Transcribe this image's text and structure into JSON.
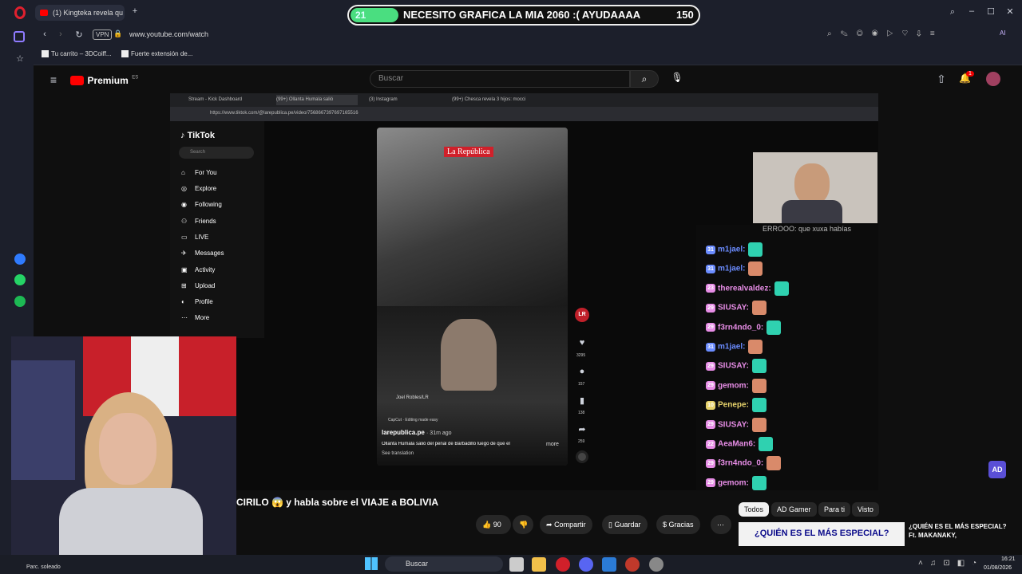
{
  "browser": {
    "tab_title": "(1) Kingteka revela qu",
    "url": "www.youtube.com/watch",
    "bookmarks": [
      "Tu carrito – 3DCoiff...",
      "Fuerte extensión de..."
    ],
    "vpn_label": "VPN",
    "ai_label": "AI"
  },
  "goal_banner": {
    "current": "21",
    "text": "NECESITO GRAFICA LA MIA 2060 :( AYUDAAAA",
    "target": "150"
  },
  "youtube": {
    "logo": "Premium",
    "logo_sup": "ES",
    "search_placeholder": "Buscar",
    "notif_count": "1",
    "video_title_suffix": "CIRILO 😱 y habla sobre el VIAJE a BOLIVIA",
    "likes": "90",
    "share": "Compartir",
    "save": "Guardar",
    "thanks": "Gracias",
    "chips": [
      "Todos",
      "AD Gamer",
      "Para ti",
      "Visto"
    ],
    "rec_title": "¿QUIÉN ES EL MÁS ESPECIAL? Ft. MAKANAKY,",
    "rec_thumb_text": "¿QUIÉN ES EL MÁS ESPECIAL?"
  },
  "inner_browser": {
    "tabs": [
      "Stream - Kick Dashboard",
      "(99+) Ollanta Humala salió",
      "(3) Instagram",
      "(99+) Chesca revela 3 hijos: mocci"
    ],
    "url": "https://www.tiktok.com/@larepublica.pe/video/7568667397697165516"
  },
  "tiktok": {
    "logo": "TikTok",
    "search": "Search",
    "menu": [
      "For You",
      "Explore",
      "Following",
      "Friends",
      "LIVE",
      "Messages",
      "Activity",
      "Upload",
      "Profile",
      "More"
    ],
    "overlay_brand": "La República",
    "author": "larepublica.pe",
    "time": "· 31m ago",
    "caption": "Ollanta Humala salió del penal de Barbadillo luego de que el",
    "more": "more",
    "see_translation": "See translation",
    "capcut": "CapCut · Editing made easy",
    "credit": "Joel Robles/LR",
    "lr_badge": "LR",
    "counts": [
      "3295",
      "157",
      "138",
      "259"
    ]
  },
  "chat": {
    "header": "ERROOO: que xuxa habías",
    "messages": [
      {
        "user": "m1jael:",
        "badge": "31",
        "color": "#6b8cff"
      },
      {
        "user": "m1jael:",
        "badge": "31",
        "color": "#6b8cff"
      },
      {
        "user": "therealvaldez:",
        "badge": "23",
        "color": "#e78de6"
      },
      {
        "user": "SIUSAY:",
        "badge": "29",
        "color": "#e78de6"
      },
      {
        "user": "f3rn4ndo_0:",
        "badge": "29",
        "color": "#e78de6"
      },
      {
        "user": "m1jael:",
        "badge": "31",
        "color": "#6b8cff"
      },
      {
        "user": "SIUSAY:",
        "badge": "29",
        "color": "#e78de6"
      },
      {
        "user": "gemom:",
        "badge": "29",
        "color": "#e78de6"
      },
      {
        "user": "Penepe:",
        "badge": "10",
        "color": "#e7d36b"
      },
      {
        "user": "SIUSAY:",
        "badge": "29",
        "color": "#e78de6"
      },
      {
        "user": "AeaMan6:",
        "badge": "22",
        "color": "#e78de6"
      },
      {
        "user": "f3rn4ndo_0:",
        "badge": "29",
        "color": "#e78de6"
      },
      {
        "user": "gemom:",
        "badge": "29",
        "color": "#e78de6"
      }
    ],
    "watermark": "AD"
  },
  "taskbar": {
    "weather": "Parc. soleado",
    "search": "Buscar",
    "time": "16:21",
    "date": "01/08/2026"
  }
}
